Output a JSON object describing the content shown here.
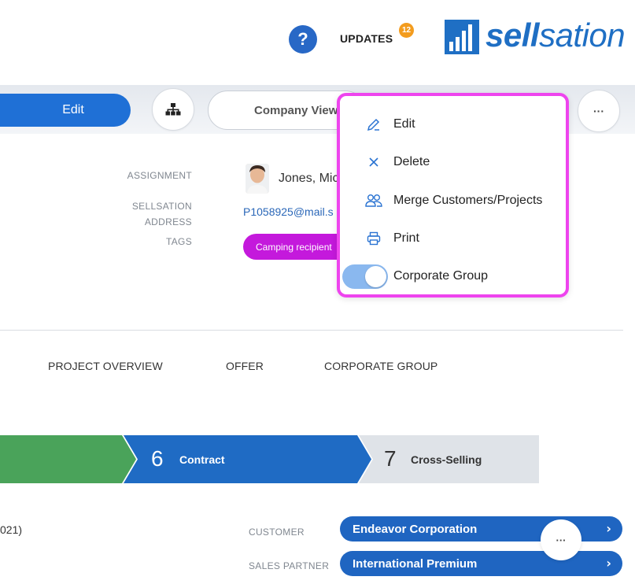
{
  "header": {
    "help_glyph": "?",
    "updates_label": "UPDATES",
    "updates_count": "12",
    "logo_bold": "sell",
    "logo_thin": "sation",
    "brand_color": "#1f6fc4"
  },
  "toolbar": {
    "edit_label": "Edit",
    "company_view_label": "Company View",
    "more_label": "···",
    "accent_color": "#1f70d6"
  },
  "details": {
    "assignment_label": "ASSIGNMENT",
    "assignee_name": "Jones, Mic",
    "address_label_line1": "SELLSATION",
    "address_label_line2": "ADDRESS",
    "email": "P1058925@mail.s",
    "tags_label": "TAGS",
    "tag_value": "Camping recipient",
    "tag_color": "#c419dc"
  },
  "tabs": [
    {
      "label": "PROJECT OVERVIEW"
    },
    {
      "label": "OFFER"
    },
    {
      "label": "CORPORATE GROUP"
    }
  ],
  "pipeline": {
    "steps": [
      {
        "number": "",
        "label": "",
        "state": "done",
        "color": "#4aa35a"
      },
      {
        "number": "6",
        "label": "Contract",
        "state": "current",
        "color": "#1f6bc4"
      },
      {
        "number": "7",
        "label": "Cross-Selling",
        "state": "upcoming",
        "color": "#dfe3e8"
      }
    ]
  },
  "bottom": {
    "year_fragment": "021)",
    "customer_label": "CUSTOMER",
    "customer_value": "Endeavor Corporation",
    "sales_partner_label": "SALES PARTNER",
    "sales_partner_value": "International Premium",
    "more_label": "···"
  },
  "menu": {
    "items": [
      {
        "label": "Edit",
        "icon": "pencil-icon"
      },
      {
        "label": "Delete",
        "icon": "close-icon"
      },
      {
        "label": "Merge Customers/Projects",
        "icon": "users-icon"
      },
      {
        "label": "Print",
        "icon": "printer-icon"
      },
      {
        "label": "Corporate Group",
        "icon": "toggle-switch",
        "toggle_on": true
      }
    ],
    "highlight_color": "#ee44ee"
  }
}
